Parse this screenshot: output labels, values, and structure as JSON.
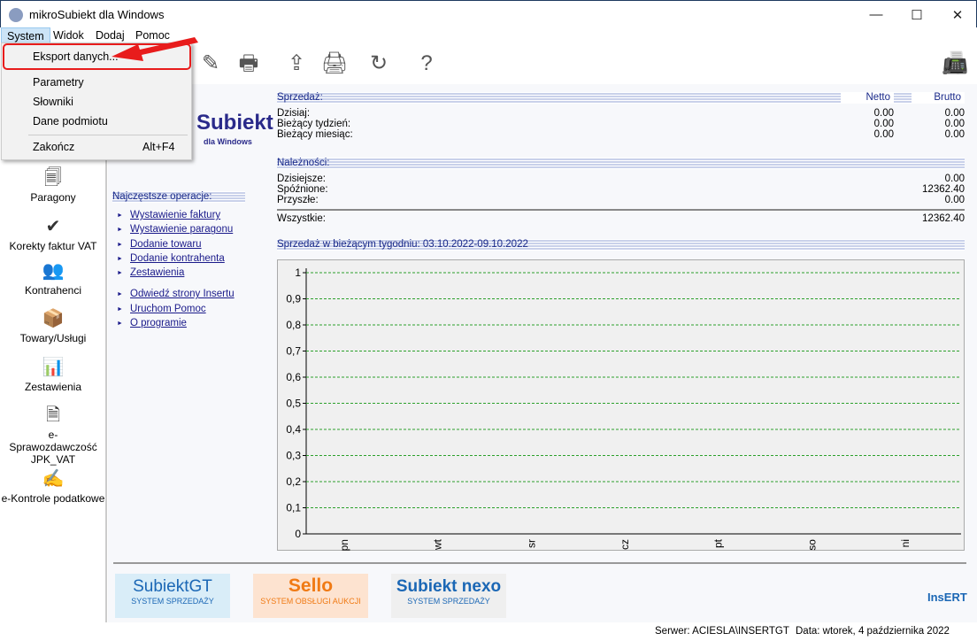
{
  "window": {
    "title": "mikroSubiekt dla Windows",
    "minimize": "—",
    "maximize": "☐",
    "close": "✕"
  },
  "menubar": [
    "System",
    "Widok",
    "Dodaj",
    "Pomoc"
  ],
  "dropdown": {
    "items": [
      {
        "label": "Eksport danych...",
        "highlighted": true
      },
      {
        "label": "Parametry"
      },
      {
        "label": "Słowniki"
      },
      {
        "label": "Dane podmiotu"
      },
      {
        "label": "Zakończ",
        "shortcut": "Alt+F4"
      }
    ],
    "annotation_color": "#e81c1c"
  },
  "toolbar": [
    "pen-icon",
    "printer-icon",
    "export-icon",
    "print-icon",
    "refresh-icon",
    "help-icon",
    "fax-icon"
  ],
  "sidebar": [
    "Paragony",
    "Korekty faktur VAT",
    "Kontrahenci",
    "Towary/Usługi",
    "Zestawienia",
    "e-Sprawozdawczość JPK_VAT",
    "e-Kontrole podatkowe"
  ],
  "brand": {
    "name": "Subiekt",
    "sub": "dla Windows"
  },
  "ops": {
    "title": "Najczęstsze operacje:",
    "links": [
      "Wystawienie faktury",
      "Wystawienie paragonu",
      "Dodanie towaru",
      "Dodanie kontrahenta",
      "Zestawienia"
    ],
    "links2": [
      "Odwiedź strony Insertu",
      "Uruchom Pomoc",
      "O programie"
    ]
  },
  "sales": {
    "title": "Sprzedaż:",
    "netto": "Netto",
    "brutto": "Brutto",
    "rows": [
      {
        "label": "Dzisiaj:",
        "netto": "0.00",
        "brutto": "0.00"
      },
      {
        "label": "Bieżący tydzień:",
        "netto": "0.00",
        "brutto": "0.00"
      },
      {
        "label": "Bieżący miesiąc:",
        "netto": "0.00",
        "brutto": "0.00"
      }
    ]
  },
  "receivables": {
    "title": "Należności:",
    "rows": [
      {
        "label": "Dzisiejsze:",
        "value": "0.00"
      },
      {
        "label": "Spóźnione:",
        "value": "12362.40"
      },
      {
        "label": "Przyszłe:",
        "value": "0.00"
      }
    ],
    "total_label": "Wszystkie:",
    "total": "12362.40"
  },
  "chart_title": "Sprzedaż w bieżącym tygodniu: 03.10.2022-09.10.2022",
  "chart_data": {
    "type": "bar",
    "categories": [
      "pn",
      "wt",
      "sr",
      "cz",
      "pt",
      "so",
      "ni"
    ],
    "values": [
      0,
      0,
      0,
      0,
      0,
      0,
      0
    ],
    "yticks": [
      "0",
      "0,1",
      "0,2",
      "0,3",
      "0,4",
      "0,5",
      "0,6",
      "0,7",
      "0,8",
      "0,9",
      "1"
    ],
    "ylim": [
      0,
      1
    ],
    "grid": true,
    "grid_color": "#2ca02c"
  },
  "logos": [
    {
      "name": "SubiektGT",
      "sub": "SYSTEM SPRZEDAŻY"
    },
    {
      "name": "Sello",
      "sub": "SYSTEM OBSŁUGI AUKCJI"
    },
    {
      "name": "Subiekt nexo",
      "sub": "SYSTEM SPRZEDAŻY"
    }
  ],
  "insert": "InsERT",
  "status": {
    "server": "Serwer: ACIESLA\\INSERTGT",
    "date": "Data: wtorek, 4 października 2022"
  }
}
